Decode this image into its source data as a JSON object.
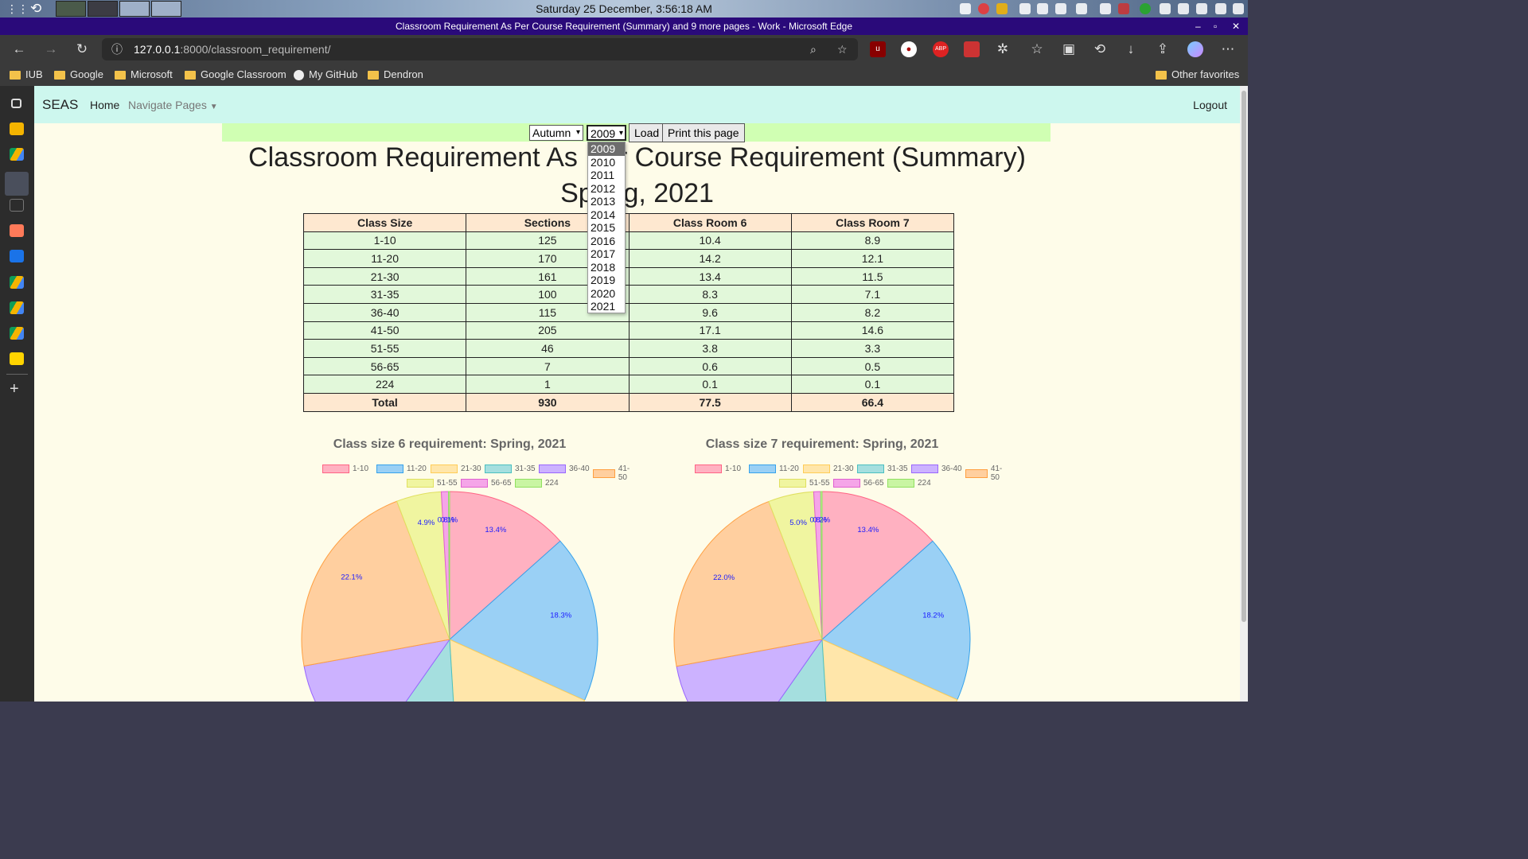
{
  "desktop": {
    "clock": "Saturday 25 December,  3:56:18 AM"
  },
  "window": {
    "title": "Classroom Requirement As Per Course Requirement (Summary) and 9 more pages - Work - Microsoft Edge"
  },
  "browser": {
    "url_host": "127.0.0.1",
    "url_path": ":8000/classroom_requirement/",
    "bookmarks": [
      "IUB",
      "Google",
      "Microsoft",
      "Google Classroom",
      "My GitHub",
      "Dendron"
    ],
    "other_favorites": "Other favorites",
    "ext_abp": "ABP"
  },
  "nav": {
    "brand": "SEAS",
    "home": "Home",
    "navigate": "Navigate Pages",
    "logout": "Logout"
  },
  "controls": {
    "semester": "Autumn",
    "year": "2009",
    "load": "Load",
    "print": "Print this page",
    "year_options": [
      "2009",
      "2010",
      "2011",
      "2012",
      "2013",
      "2014",
      "2015",
      "2016",
      "2017",
      "2018",
      "2019",
      "2020",
      "2021"
    ]
  },
  "heading": {
    "line1": "Classroom Requirement As Per Course Requirement (Summary)",
    "line2": "Spring, 2021"
  },
  "table": {
    "headers": [
      "Class Size",
      "Sections",
      "Class Room 6",
      "Class Room 7"
    ],
    "rows": [
      [
        "1-10",
        "125",
        "10.4",
        "8.9"
      ],
      [
        "11-20",
        "170",
        "14.2",
        "12.1"
      ],
      [
        "21-30",
        "161",
        "13.4",
        "11.5"
      ],
      [
        "31-35",
        "100",
        "8.3",
        "7.1"
      ],
      [
        "36-40",
        "115",
        "9.6",
        "8.2"
      ],
      [
        "41-50",
        "205",
        "17.1",
        "14.6"
      ],
      [
        "51-55",
        "46",
        "3.8",
        "3.3"
      ],
      [
        "56-65",
        "7",
        "0.6",
        "0.5"
      ],
      [
        "224",
        "1",
        "0.1",
        "0.1"
      ]
    ],
    "total": [
      "Total",
      "930",
      "77.5",
      "66.4"
    ]
  },
  "chart_data": [
    {
      "type": "pie",
      "title": "Class size 6 requirement: Spring, 2021",
      "categories": [
        "1-10",
        "11-20",
        "21-30",
        "31-35",
        "36-40",
        "41-50",
        "51-55",
        "56-65",
        "224"
      ],
      "values": [
        10.4,
        14.2,
        13.4,
        8.3,
        9.6,
        17.1,
        3.8,
        0.6,
        0.1
      ],
      "labels": [
        "13.4%",
        "18.3%",
        "",
        "",
        "",
        "22.1%",
        "4.9%",
        "0.8%",
        "0.1%"
      ],
      "colors": [
        "#ffb1c1",
        "#9ad0f5",
        "#ffe6aa",
        "#a5dfdf",
        "#ccb2ff",
        "#ffcf9f",
        "#f0f5a0",
        "#f5a5e8",
        "#c9f5a3"
      ],
      "borders": [
        "#ff6384",
        "#36a2eb",
        "#ffcd56",
        "#4bc0c0",
        "#9966ff",
        "#ff9f40",
        "#e0e060",
        "#e060d0",
        "#90e060"
      ],
      "legend": "top"
    },
    {
      "type": "pie",
      "title": "Class size 7 requirement: Spring, 2021",
      "categories": [
        "1-10",
        "11-20",
        "21-30",
        "31-35",
        "36-40",
        "41-50",
        "51-55",
        "56-65",
        "224"
      ],
      "values": [
        8.9,
        12.1,
        11.5,
        7.1,
        8.2,
        14.6,
        3.3,
        0.5,
        0.1
      ],
      "labels": [
        "13.4%",
        "18.2%",
        "",
        "",
        "",
        "22.0%",
        "5.0%",
        "0.8%",
        "0.2%"
      ],
      "colors": [
        "#ffb1c1",
        "#9ad0f5",
        "#ffe6aa",
        "#a5dfdf",
        "#ccb2ff",
        "#ffcf9f",
        "#f0f5a0",
        "#f5a5e8",
        "#c9f5a3"
      ],
      "borders": [
        "#ff6384",
        "#36a2eb",
        "#ffcd56",
        "#4bc0c0",
        "#9966ff",
        "#ff9f40",
        "#e0e060",
        "#e060d0",
        "#90e060"
      ],
      "legend": "top"
    }
  ]
}
